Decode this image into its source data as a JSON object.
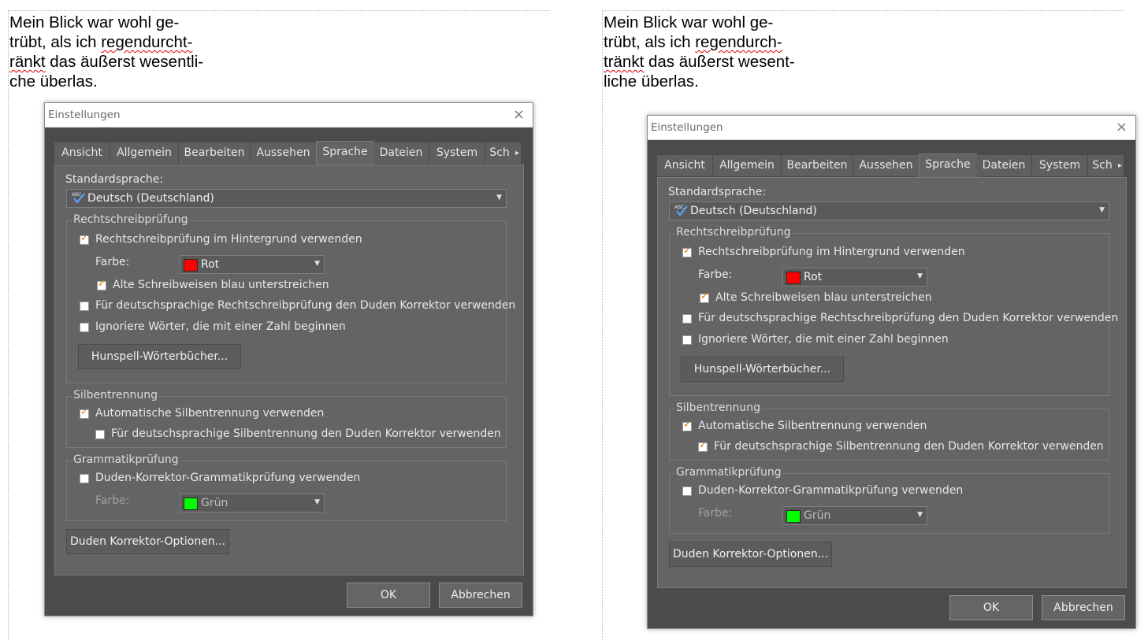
{
  "left_pane": {
    "doc_lines": [
      "Mein Blick war wohl ge-",
      "trübt, als ich ",
      "regendurcht-",
      "ränkt",
      " das äußerst wesentli-",
      "che überlas."
    ]
  },
  "right_pane": {
    "doc_lines": [
      "Mein Blick war wohl ge-",
      "trübt, als ich ",
      "regendurch-",
      "tränkt",
      " das äußerst wesent-",
      "liche überlas."
    ]
  },
  "dialog": {
    "title": "Einstellungen",
    "close_icon": "×",
    "tabs": [
      "Ansicht",
      "Allgemein",
      "Bearbeiten",
      "Aussehen",
      "Sprache",
      "Dateien",
      "System",
      "Sch"
    ],
    "active_tab": "Sprache",
    "tab_scroll_icon": "▸",
    "standard_language_label": "Standardsprache:",
    "standard_language_value": "Deutsch (Deutschland)",
    "spellcheck_group": "Rechtschreibprüfung",
    "bg_spellcheck": "Rechtschreibprüfung im Hintergrund verwenden",
    "color_label": "Farbe:",
    "spell_color": "Rot",
    "spell_color_hex": "#ff0000",
    "old_spellings": "Alte Schreibweisen blau unterstreichen",
    "duden_spell": "Für deutschsprachige Rechtschreibprüfung den Duden Korrektor verwenden",
    "ignore_numbers": "Ignoriere Wörter, die mit einer Zahl beginnen",
    "hunspell_button": "Hunspell-Wörterbücher...",
    "hyphen_group": "Silbentrennung",
    "auto_hyphen": "Automatische Silbentrennung verwenden",
    "duden_hyphen": "Für deutschsprachige Silbentrennung den Duden Korrektor verwenden",
    "grammar_group": "Grammatikprüfung",
    "duden_grammar": "Duden-Korrektor-Grammatikprüfung verwenden",
    "grammar_color": "Grün",
    "grammar_color_hex": "#00ff00",
    "duden_options_button": "Duden Korrektor-Optionen...",
    "ok_button": "OK",
    "cancel_button": "Abbrechen",
    "dropdown_icon": "▼"
  },
  "states": {
    "left": {
      "bg_spellcheck": true,
      "old_spellings": true,
      "duden_spell": false,
      "ignore_numbers": false,
      "auto_hyphen": true,
      "duden_hyphen": false,
      "duden_grammar": false
    },
    "right": {
      "bg_spellcheck": true,
      "old_spellings": true,
      "duden_spell": false,
      "ignore_numbers": false,
      "auto_hyphen": true,
      "duden_hyphen": true,
      "duden_grammar": false
    }
  }
}
